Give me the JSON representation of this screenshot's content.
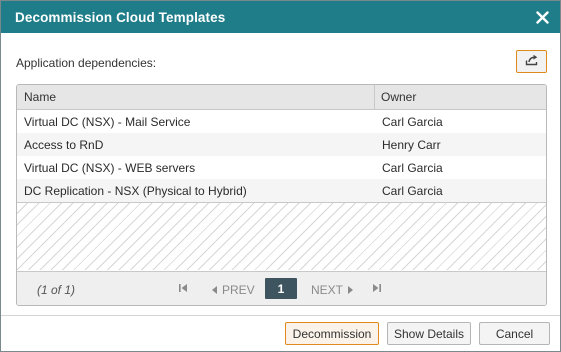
{
  "dialog": {
    "title": "Decommission Cloud Templates",
    "close_icon": "close-icon"
  },
  "dependencies_label": "Application dependencies:",
  "export_icon": "export-icon",
  "table": {
    "columns": [
      "Name",
      "Owner"
    ],
    "rows": [
      {
        "name": "Virtual DC (NSX) - Mail Service",
        "owner": "Carl Garcia"
      },
      {
        "name": "Access to RnD",
        "owner": "Henry Carr"
      },
      {
        "name": "Virtual DC (NSX) - WEB servers",
        "owner": "Carl Garcia"
      },
      {
        "name": "DC Replication - NSX (Physical to Hybrid)",
        "owner": "Carl Garcia"
      }
    ]
  },
  "pager": {
    "count": "(1 of 1)",
    "prev": "PREV",
    "current": "1",
    "next": "NEXT"
  },
  "buttons": {
    "decommission": "Decommission",
    "show_details": "Show Details",
    "cancel": "Cancel"
  },
  "colors": {
    "titlebar": "#1e7d89",
    "accent_border": "#e08a1e",
    "pager_current": "#3e5560"
  }
}
